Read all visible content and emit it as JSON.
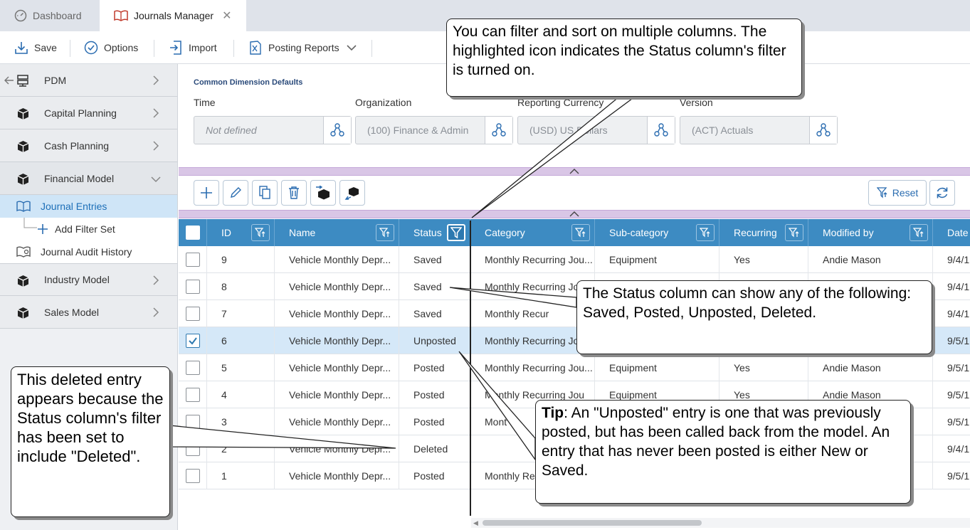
{
  "tabs": {
    "dashboard": "Dashboard",
    "journals": "Journals Manager"
  },
  "toolbar": {
    "save": "Save",
    "options": "Options",
    "import": "Import",
    "posting_reports": "Posting Reports"
  },
  "sidebar": {
    "pdm": "PDM",
    "capital": "Capital Planning",
    "cash": "Cash Planning",
    "financial": "Financial Model",
    "journal_entries": "Journal Entries",
    "add_filter_set": "Add Filter Set",
    "journal_audit": "Journal Audit History",
    "industry": "Industry Model",
    "sales": "Sales Model"
  },
  "defaults": {
    "title": "Common Dimension Defaults",
    "time_label": "Time",
    "time_value": "Not defined",
    "org_label": "Organization",
    "org_value": "(100) Finance & Admin",
    "currency_label": "Reporting Currency",
    "currency_value": "(USD) US Dollars",
    "version_label": "Version",
    "version_value": "(ACT) Actuals"
  },
  "grid_tools": {
    "reset": "Reset"
  },
  "grid": {
    "headers": {
      "id": "ID",
      "name": "Name",
      "status": "Status",
      "category": "Category",
      "subcategory": "Sub-category",
      "recurring": "Recurring",
      "modified": "Modified by",
      "date": "Date"
    },
    "rows": [
      {
        "id": "9",
        "name": "Vehicle Monthly Depr...",
        "status": "Saved",
        "category": "Monthly Recurring Jou...",
        "subcategory": "Equipment",
        "recurring": "Yes",
        "modified": "Andie Mason",
        "date": "9/4/1"
      },
      {
        "id": "8",
        "name": "Vehicle Monthly Depr...",
        "status": "Saved",
        "category": "Monthly Recurring Jo",
        "subcategory": "",
        "recurring": "",
        "modified": "",
        "date": "9/4/1"
      },
      {
        "id": "7",
        "name": "Vehicle Monthly Depr...",
        "status": "Saved",
        "category": "Monthly Recur",
        "subcategory": "",
        "recurring": "",
        "modified": "",
        "date": "9/4/1"
      },
      {
        "id": "6",
        "name": "Vehicle Monthly Depr...",
        "status": "Unposted",
        "category": "Monthly Recurring Jo",
        "subcategory": "",
        "recurring": "",
        "modified": "",
        "date": "9/5/1"
      },
      {
        "id": "5",
        "name": "Vehicle Monthly Depr...",
        "status": "Posted",
        "category": "Monthly Recurring Jou...",
        "subcategory": "Equipment",
        "recurring": "Yes",
        "modified": "Andie Mason",
        "date": "9/5/1"
      },
      {
        "id": "4",
        "name": "Vehicle Monthly Depr...",
        "status": "Posted",
        "category": "Monthly Recurring Jou",
        "subcategory": "Equipment",
        "recurring": "Yes",
        "modified": "Andie Mason",
        "date": "9/5/1"
      },
      {
        "id": "3",
        "name": "Vehicle Monthly Depr...",
        "status": "Posted",
        "category": "Mont",
        "subcategory": "",
        "recurring": "",
        "modified": "",
        "date": "9/5/1"
      },
      {
        "id": "2",
        "name": "Vehicle Monthly Depr...",
        "status": "Deleted",
        "category": "",
        "subcategory": "",
        "recurring": "",
        "modified": "",
        "date": "9/4/1"
      },
      {
        "id": "1",
        "name": "Vehicle Monthly Depr...",
        "status": "Posted",
        "category": "Monthly Re",
        "subcategory": "",
        "recurring": "",
        "modified": "",
        "date": "9/5/1"
      }
    ]
  },
  "callouts": {
    "filter": "You can filter and sort on multiple columns. The highlighted icon indicates the Status column's filter is turned on.",
    "status": "The Status column can show any of the following: Saved, Posted, Unposted, Deleted.",
    "deleted": "This deleted entry appears because the Status column's filter has been set to include \"Deleted\".",
    "tip_bold": "Tip",
    "tip_text": ": An \"Unposted\" entry is one that was previously posted, but has been called back from the model. An entry that has never been posted is either New or Saved."
  }
}
